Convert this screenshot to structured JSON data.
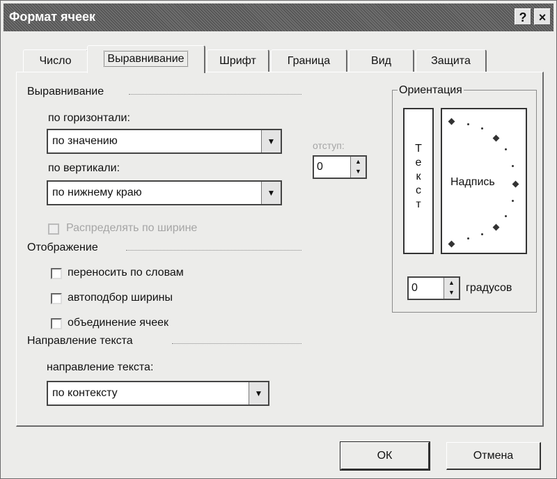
{
  "window": {
    "title": "Формат ячеек",
    "help_icon": "?",
    "close_icon": "×"
  },
  "tabs": [
    {
      "label": "Число"
    },
    {
      "label": "Выравнивание"
    },
    {
      "label": "Шрифт"
    },
    {
      "label": "Граница"
    },
    {
      "label": "Вид"
    },
    {
      "label": "Защита"
    }
  ],
  "alignment": {
    "section_title": "Выравнивание",
    "horizontal_label": "по горизонтали:",
    "horizontal_value": "по значению",
    "vertical_label": "по вертикали:",
    "vertical_value": "по нижнему краю",
    "indent_label": "отступ:",
    "indent_value": "0",
    "distribute_label": "Распределять по ширине"
  },
  "display": {
    "section_title": "Отображение",
    "wrap_label": "переносить по словам",
    "shrink_label": "автоподбор ширины",
    "merge_label": "объединение ячеек"
  },
  "direction": {
    "section_title": "Направление текста",
    "label": "направление текста:",
    "value": "по контексту"
  },
  "orientation": {
    "section_title": "Ориентация",
    "vertical_text": [
      "Т",
      "е",
      "к",
      "с",
      "т"
    ],
    "dial_label": "Надпись",
    "degrees_value": "0",
    "degrees_label": "градусов"
  },
  "buttons": {
    "ok": "ОК",
    "cancel": "Отмена"
  }
}
